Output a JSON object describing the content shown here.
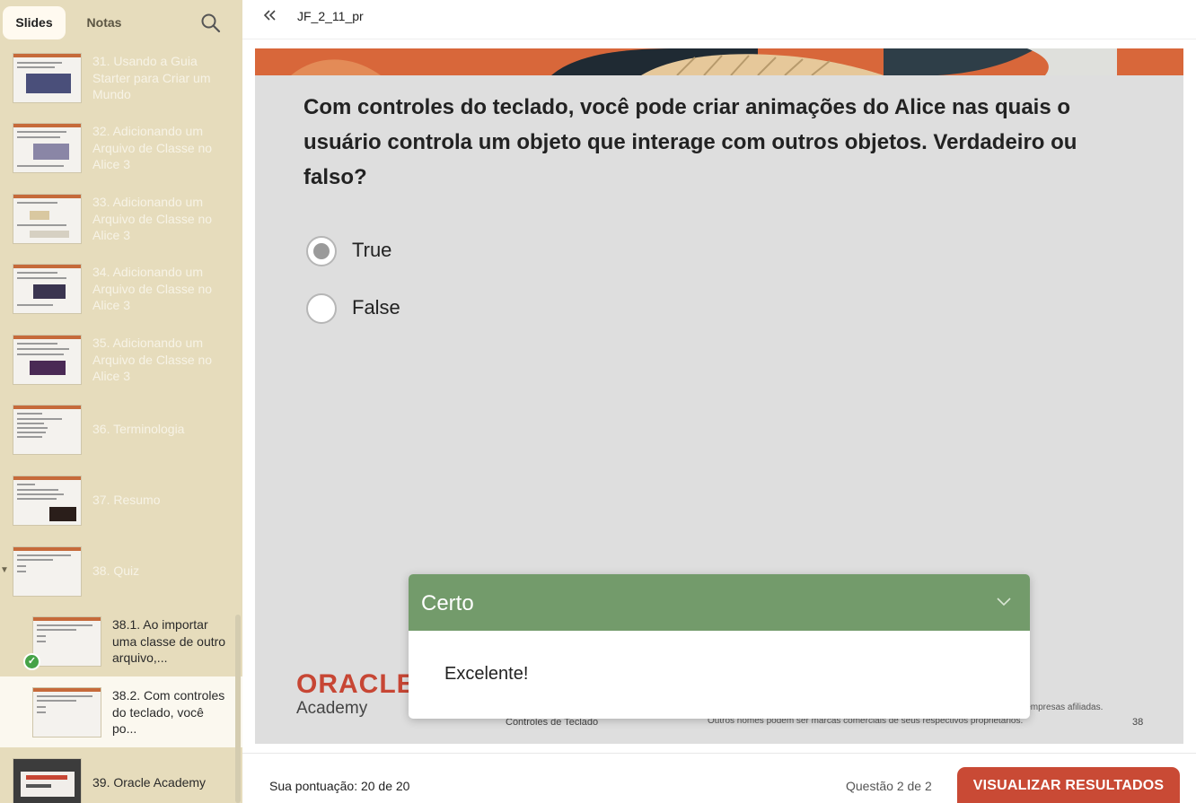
{
  "sidebar": {
    "tabs": {
      "slides": "Slides",
      "notes": "Notas"
    },
    "search_icon": "search-icon",
    "items": [
      {
        "label": "31. Usando a Guia Starter para Criar um Mundo"
      },
      {
        "label": "32. Adicionando um Arquivo de Classe no Alice 3"
      },
      {
        "label": "33. Adicionando um Arquivo de Classe no Alice 3"
      },
      {
        "label": "34. Adicionando um Arquivo de Classe no Alice 3"
      },
      {
        "label": "35. Adicionando um Arquivo de Classe no Alice 3"
      },
      {
        "label": "36. Terminologia"
      },
      {
        "label": "37. Resumo"
      },
      {
        "label": "38. Quiz"
      },
      {
        "label": "38.1. Ao importar uma classe de outro arquivo,..."
      },
      {
        "label": "38.2.  Com controles do teclado, você po..."
      },
      {
        "label": "39. Oracle Academy"
      }
    ]
  },
  "topbar": {
    "title": "JF_2_11_pr"
  },
  "slide": {
    "question": " Com controles do teclado, você pode criar animações do Alice nas quais o usuário controla um objeto que interage com outros objetos. Verdadeiro ou falso?",
    "options": [
      {
        "label": "True",
        "selected": true
      },
      {
        "label": "False",
        "selected": false
      }
    ],
    "logo": {
      "word": "ORACLE",
      "sub": "Academy"
    },
    "footer_topic": "Controles de Teclado",
    "footer_legal": "MySQL são marcas comerciais registradas da Oracle Corporation e/ou de suas empresas afiliadas. Outros nomes podem ser marcas comerciais de seus respectivos proprietários.",
    "page_number": "38"
  },
  "feedback": {
    "title": "Certo",
    "message": "Excelente!"
  },
  "bottom": {
    "score": "Sua pontuação: 20 de 20",
    "progress": "Questão 2 de 2",
    "results_button": "VISUALIZAR RESULTADOS"
  },
  "colors": {
    "sidebar_bg": "#e6dcbc",
    "correct_green": "#739b6b",
    "accent_red": "#c94a35",
    "oracle_red": "#c74634"
  }
}
